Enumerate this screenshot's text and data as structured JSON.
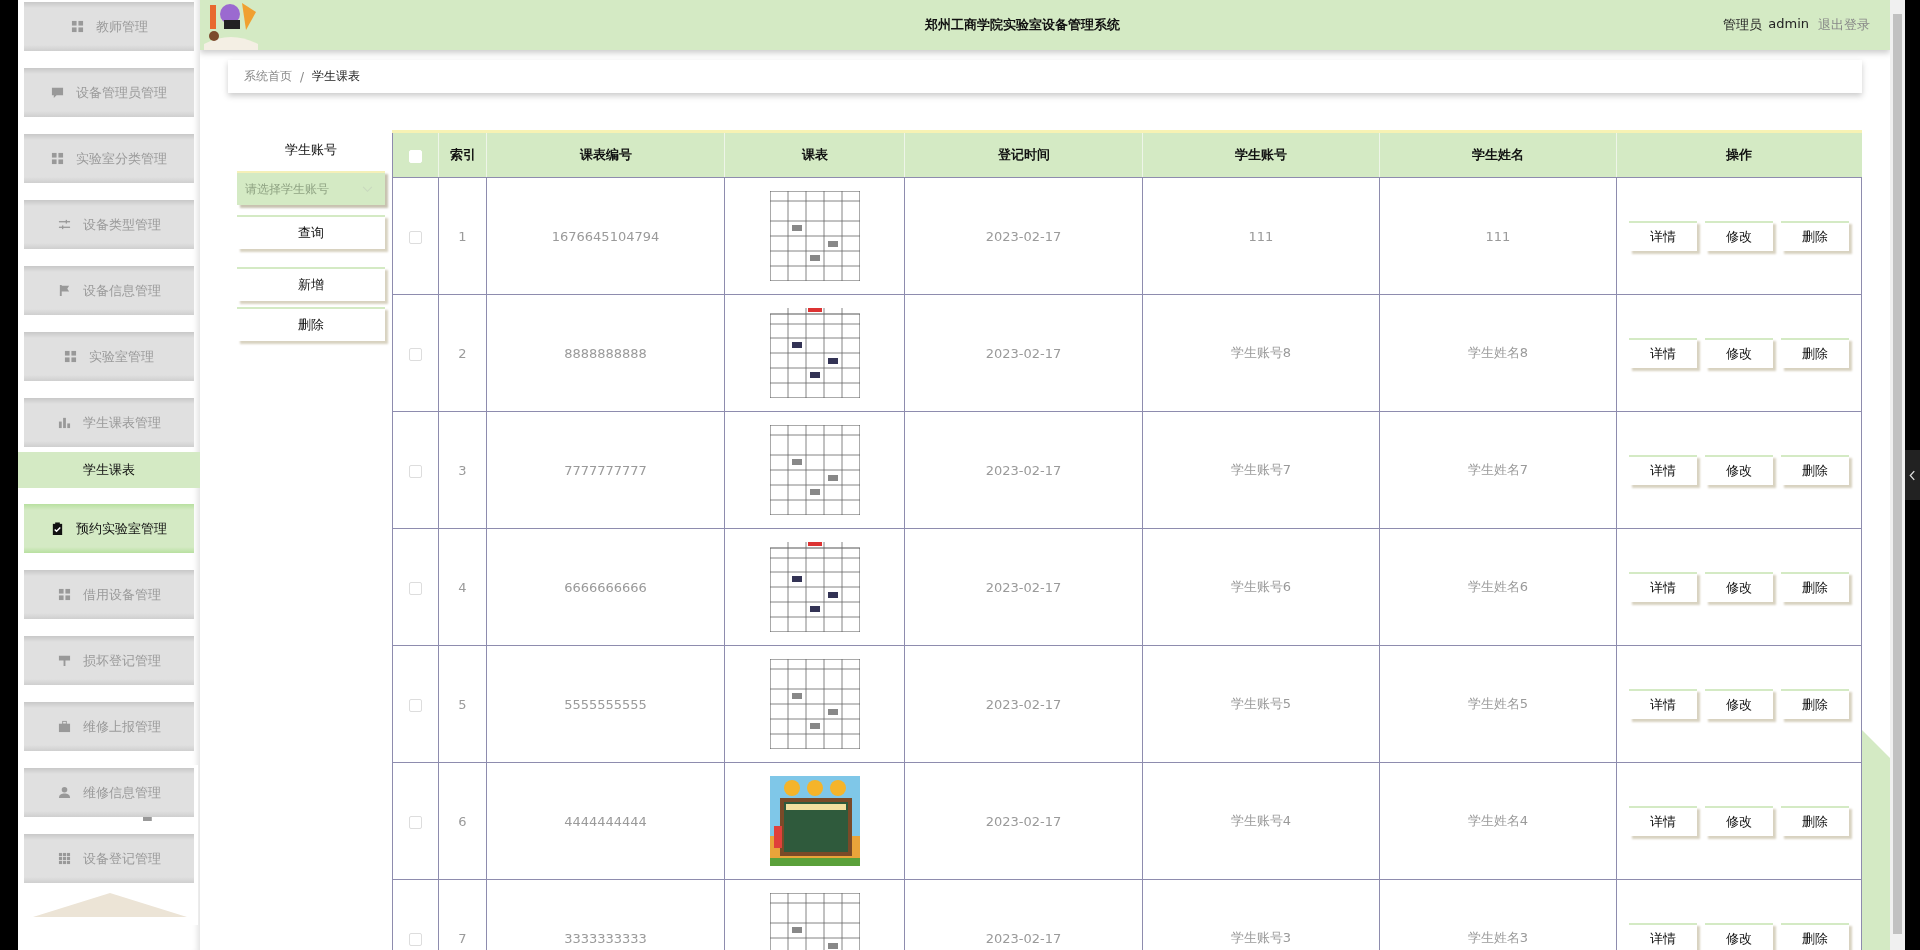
{
  "sidebar": {
    "items": [
      {
        "label": "教师管理",
        "highlighted": false
      },
      {
        "label": "设备管理员管理",
        "highlighted": false
      },
      {
        "label": "实验室分类管理",
        "highlighted": false
      },
      {
        "label": "设备类型管理",
        "highlighted": false
      },
      {
        "label": "设备信息管理",
        "highlighted": false
      },
      {
        "label": "实验室管理",
        "highlighted": false
      },
      {
        "label": "学生课表管理",
        "highlighted": false,
        "children": [
          {
            "label": "学生课表",
            "selected": true
          }
        ]
      },
      {
        "label": "预约实验室管理",
        "highlighted": true
      },
      {
        "label": "借用设备管理",
        "highlighted": false
      },
      {
        "label": "损坏登记管理",
        "highlighted": false
      },
      {
        "label": "维修上报管理",
        "highlighted": false
      },
      {
        "label": "维修信息管理",
        "highlighted": false
      },
      {
        "label": "设备登记管理",
        "highlighted": false
      }
    ]
  },
  "header": {
    "title": "郑州工商学院实验室设备管理系统",
    "role": "管理员",
    "user": "admin",
    "logout": "退出登录"
  },
  "breadcrumb": [
    "系统首页",
    "/",
    "学生课表"
  ],
  "search": {
    "label": "学生账号",
    "placeholder": "请选择学生账号",
    "buttons": [
      "查询",
      "新增",
      "删除"
    ]
  },
  "table": {
    "select_all": {
      "checked": false
    },
    "columns": [
      "索引",
      "课表编号",
      "课表",
      "登记时间",
      "学生账号",
      "学生姓名",
      "操作"
    ],
    "rows": [
      {
        "checked": false,
        "index": "1",
        "number": "1676645104794",
        "time": "2023-02-17",
        "account": "111",
        "name": "111",
        "actions": [
          "详情",
          "修改",
          "删除"
        ]
      },
      {
        "checked": false,
        "index": "2",
        "number": "8888888888",
        "time": "2023-02-17",
        "account": "学生账号8",
        "name": "学生姓名8",
        "actions": [
          "详情",
          "修改",
          "删除"
        ]
      },
      {
        "checked": false,
        "index": "3",
        "number": "7777777777",
        "time": "2023-02-17",
        "account": "学生账号7",
        "name": "学生姓名7",
        "actions": [
          "详情",
          "修改",
          "删除"
        ]
      },
      {
        "checked": false,
        "index": "4",
        "number": "6666666666",
        "time": "2023-02-17",
        "account": "学生账号6",
        "name": "学生姓名6",
        "actions": [
          "详情",
          "修改",
          "删除"
        ]
      },
      {
        "checked": false,
        "index": "5",
        "number": "5555555555",
        "time": "2023-02-17",
        "account": "学生账号5",
        "name": "学生姓名5",
        "actions": [
          "详情",
          "修改",
          "删除"
        ]
      },
      {
        "checked": false,
        "index": "6",
        "number": "4444444444",
        "time": "2023-02-17",
        "account": "学生账号4",
        "name": "学生姓名4",
        "actions": [
          "详情",
          "修改",
          "删除"
        ]
      },
      {
        "checked": false,
        "index": "7",
        "number": "3333333333",
        "time": "2023-02-17",
        "account": "学生账号3",
        "name": "学生姓名3",
        "actions": [
          "详情",
          "修改",
          "删除"
        ]
      }
    ]
  }
}
